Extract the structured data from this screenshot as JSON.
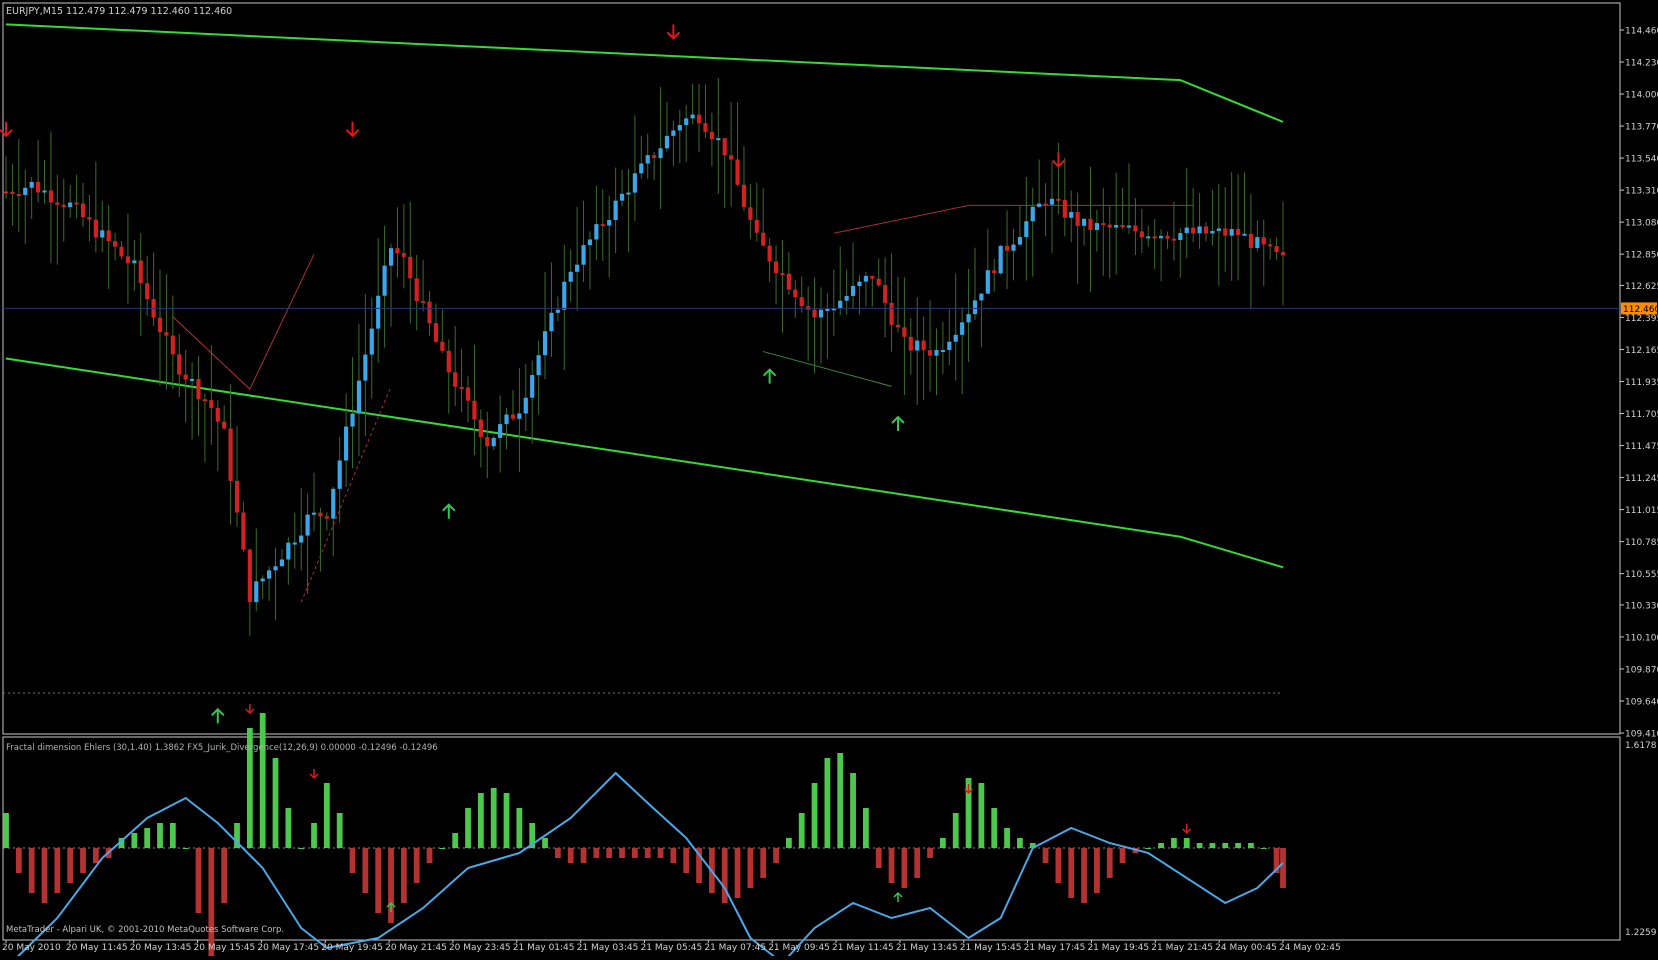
{
  "window": {
    "symbol_info": "EURJPY,M15  112.479 112.479 112.460 112.460",
    "current_price_label": "112.460"
  },
  "colors": {
    "background": "#000000",
    "frame": "#c8c8c8",
    "channel_line": "#32dc32",
    "bull_candle": "#3aa8e8",
    "bear_candle": "#d42020",
    "wick": "#3a6e28",
    "up_arrow": "#32c850",
    "down_arrow": "#e01818",
    "price_tag_bg": "#ff8c00",
    "hist_pos": "#4cc84c",
    "hist_neg": "#b43232",
    "osc_line": "#4aa8e8",
    "divergence_line": "#a83030"
  },
  "main_panel": {
    "y_axis_ticks": [
      "114.460",
      "114.230",
      "114.000",
      "113.770",
      "113.540",
      "113.310",
      "113.080",
      "112.850",
      "112.625",
      "112.395",
      "112.165",
      "111.935",
      "111.705",
      "111.475",
      "111.245",
      "111.015",
      "110.785",
      "110.555",
      "110.330",
      "110.100",
      "109.870",
      "109.640",
      "109.410"
    ]
  },
  "indicator_panel": {
    "label": "Fractal dimension Ehlers (30,1.40) 1.3862  FX5_Jurik_Divergence(12,26,9) 0.00000 -0.12496 -0.12496",
    "copyright": "MetaTrader - Alpari UK, © 2001-2010 MetaQuotes Software Corp.",
    "y_axis_ticks": [
      "1.6178",
      "1.2259"
    ]
  },
  "time_axis": [
    "20 May 2010",
    "20 May 11:45",
    "20 May 13:45",
    "20 May 15:45",
    "20 May 17:45",
    "20 May 19:45",
    "20 May 21:45",
    "20 May 23:45",
    "21 May 01:45",
    "21 May 03:45",
    "21 May 05:45",
    "21 May 07:45",
    "21 May 09:45",
    "21 May 11:45",
    "21 May 13:45",
    "21 May 15:45",
    "21 May 17:45",
    "21 May 19:45",
    "21 May 21:45",
    "24 May 00:45",
    "24 May 02:45"
  ],
  "chart_data": {
    "type": "candlestick",
    "symbol": "EURJPY",
    "timeframe": "M15",
    "ylim": [
      109.41,
      114.46
    ],
    "close_anchors": [
      [
        0,
        113.3
      ],
      [
        4,
        113.35
      ],
      [
        10,
        113.2
      ],
      [
        20,
        112.75
      ],
      [
        26,
        112.1
      ],
      [
        32,
        111.75
      ],
      [
        34,
        111.55
      ],
      [
        38,
        110.4
      ],
      [
        43,
        110.7
      ],
      [
        47,
        110.95
      ],
      [
        50,
        111.0
      ],
      [
        54,
        111.75
      ],
      [
        60,
        112.9
      ],
      [
        62,
        112.8
      ],
      [
        68,
        112.1
      ],
      [
        75,
        111.5
      ],
      [
        80,
        111.75
      ],
      [
        88,
        112.75
      ],
      [
        98,
        113.4
      ],
      [
        105,
        113.8
      ],
      [
        108,
        113.85
      ],
      [
        112,
        113.6
      ],
      [
        117,
        112.95
      ],
      [
        126,
        112.4
      ],
      [
        131,
        112.55
      ],
      [
        135,
        112.7
      ],
      [
        140,
        112.2
      ],
      [
        145,
        112.15
      ],
      [
        150,
        112.45
      ],
      [
        155,
        112.85
      ],
      [
        162,
        113.25
      ],
      [
        168,
        113.05
      ],
      [
        180,
        113.0
      ],
      [
        192,
        113.0
      ],
      [
        199,
        112.8
      ]
    ],
    "channel_top": [
      [
        0,
        114.5
      ],
      [
        183,
        114.1
      ],
      [
        199,
        113.8
      ]
    ],
    "channel_bottom": [
      [
        0,
        112.1
      ],
      [
        183,
        110.82
      ],
      [
        199,
        110.6
      ]
    ],
    "current_price": 112.46,
    "fractals_up": [
      [
        33,
        109.58
      ],
      [
        69,
        111.05
      ],
      [
        119,
        112.02
      ],
      [
        139,
        111.68
      ]
    ],
    "fractals_down": [
      [
        0,
        113.7
      ],
      [
        54,
        113.7
      ],
      [
        104,
        114.4
      ],
      [
        164,
        113.48
      ]
    ],
    "divergence_lines": [
      [
        [
          26,
          112.4
        ],
        [
          38,
          111.88
        ],
        [
          48,
          112.85
        ]
      ],
      [
        [
          129,
          113.0
        ],
        [
          150,
          113.2
        ],
        [
          185,
          113.2
        ]
      ],
      [
        [
          118,
          112.15
        ],
        [
          138,
          111.9
        ]
      ]
    ],
    "dashed_lines": [
      [
        [
          26,
          112.4
        ],
        [
          38,
          111.88
        ]
      ],
      [
        [
          46,
          110.35
        ],
        [
          60,
          111.9
        ]
      ]
    ],
    "hist_bars": [
      [
        0,
        0.35
      ],
      [
        2,
        -0.25
      ],
      [
        4,
        -0.45
      ],
      [
        6,
        -0.55
      ],
      [
        8,
        -0.45
      ],
      [
        10,
        -0.35
      ],
      [
        12,
        -0.25
      ],
      [
        14,
        -0.15
      ],
      [
        16,
        -0.1
      ],
      [
        18,
        0.1
      ],
      [
        20,
        0.15
      ],
      [
        22,
        0.2
      ],
      [
        24,
        0.25
      ],
      [
        26,
        0.25
      ],
      [
        28,
        0.0
      ],
      [
        30,
        -0.65
      ],
      [
        32,
        -1.1
      ],
      [
        34,
        -0.55
      ],
      [
        36,
        0.25
      ],
      [
        38,
        1.2
      ],
      [
        40,
        1.35
      ],
      [
        42,
        0.9
      ],
      [
        44,
        0.4
      ],
      [
        46,
        0.0
      ],
      [
        48,
        0.25
      ],
      [
        50,
        0.65
      ],
      [
        52,
        0.35
      ],
      [
        54,
        -0.25
      ],
      [
        56,
        -0.45
      ],
      [
        58,
        -0.65
      ],
      [
        60,
        -0.75
      ],
      [
        62,
        -0.55
      ],
      [
        64,
        -0.35
      ],
      [
        66,
        -0.15
      ],
      [
        68,
        0.0
      ],
      [
        70,
        0.15
      ],
      [
        72,
        0.4
      ],
      [
        74,
        0.55
      ],
      [
        76,
        0.6
      ],
      [
        78,
        0.55
      ],
      [
        80,
        0.4
      ],
      [
        82,
        0.25
      ],
      [
        84,
        0.1
      ],
      [
        86,
        -0.1
      ],
      [
        88,
        -0.15
      ],
      [
        90,
        -0.15
      ],
      [
        92,
        -0.1
      ],
      [
        94,
        -0.1
      ],
      [
        96,
        -0.1
      ],
      [
        98,
        -0.1
      ],
      [
        100,
        -0.1
      ],
      [
        102,
        -0.1
      ],
      [
        104,
        -0.15
      ],
      [
        106,
        -0.25
      ],
      [
        108,
        -0.35
      ],
      [
        110,
        -0.45
      ],
      [
        112,
        -0.55
      ],
      [
        114,
        -0.5
      ],
      [
        116,
        -0.4
      ],
      [
        118,
        -0.3
      ],
      [
        120,
        -0.15
      ],
      [
        122,
        0.1
      ],
      [
        124,
        0.35
      ],
      [
        126,
        0.65
      ],
      [
        128,
        0.9
      ],
      [
        130,
        0.95
      ],
      [
        132,
        0.75
      ],
      [
        134,
        0.4
      ],
      [
        136,
        -0.2
      ],
      [
        138,
        -0.35
      ],
      [
        140,
        -0.4
      ],
      [
        142,
        -0.3
      ],
      [
        144,
        -0.1
      ],
      [
        146,
        0.1
      ],
      [
        148,
        0.35
      ],
      [
        150,
        0.7
      ],
      [
        152,
        0.65
      ],
      [
        154,
        0.4
      ],
      [
        156,
        0.2
      ],
      [
        158,
        0.1
      ],
      [
        160,
        0.05
      ],
      [
        162,
        -0.15
      ],
      [
        164,
        -0.35
      ],
      [
        166,
        -0.5
      ],
      [
        168,
        -0.55
      ],
      [
        170,
        -0.45
      ],
      [
        172,
        -0.3
      ],
      [
        174,
        -0.15
      ],
      [
        176,
        -0.05
      ],
      [
        178,
        0.0
      ],
      [
        180,
        0.05
      ],
      [
        182,
        0.1
      ],
      [
        184,
        0.1
      ],
      [
        186,
        0.05
      ],
      [
        188,
        0.05
      ],
      [
        190,
        0.05
      ],
      [
        192,
        0.05
      ],
      [
        194,
        0.05
      ],
      [
        196,
        0.0
      ],
      [
        198,
        -0.25
      ],
      [
        199,
        -0.4
      ]
    ],
    "osc_line": [
      [
        0,
        -1.2
      ],
      [
        8,
        -0.7
      ],
      [
        15,
        -0.1
      ],
      [
        22,
        0.3
      ],
      [
        28,
        0.5
      ],
      [
        33,
        0.25
      ],
      [
        40,
        -0.2
      ],
      [
        46,
        -0.8
      ],
      [
        50,
        -1.0
      ],
      [
        58,
        -0.9
      ],
      [
        65,
        -0.6
      ],
      [
        72,
        -0.2
      ],
      [
        80,
        -0.05
      ],
      [
        88,
        0.3
      ],
      [
        95,
        0.75
      ],
      [
        100,
        0.45
      ],
      [
        106,
        0.1
      ],
      [
        112,
        -0.4
      ],
      [
        116,
        -0.9
      ],
      [
        121,
        -1.15
      ],
      [
        126,
        -0.8
      ],
      [
        132,
        -0.55
      ],
      [
        138,
        -0.7
      ],
      [
        144,
        -0.6
      ],
      [
        150,
        -0.9
      ],
      [
        155,
        -0.7
      ],
      [
        160,
        0.0
      ],
      [
        166,
        0.2
      ],
      [
        172,
        0.05
      ],
      [
        178,
        -0.05
      ],
      [
        184,
        -0.3
      ],
      [
        190,
        -0.55
      ],
      [
        195,
        -0.4
      ],
      [
        199,
        -0.15
      ]
    ],
    "hist_arrows_up": [
      [
        60,
        -0.55
      ],
      [
        139,
        -0.45
      ]
    ],
    "hist_arrows_down": [
      [
        38,
        1.35
      ],
      [
        48,
        0.7
      ],
      [
        150,
        0.55
      ],
      [
        184,
        0.15
      ]
    ]
  }
}
